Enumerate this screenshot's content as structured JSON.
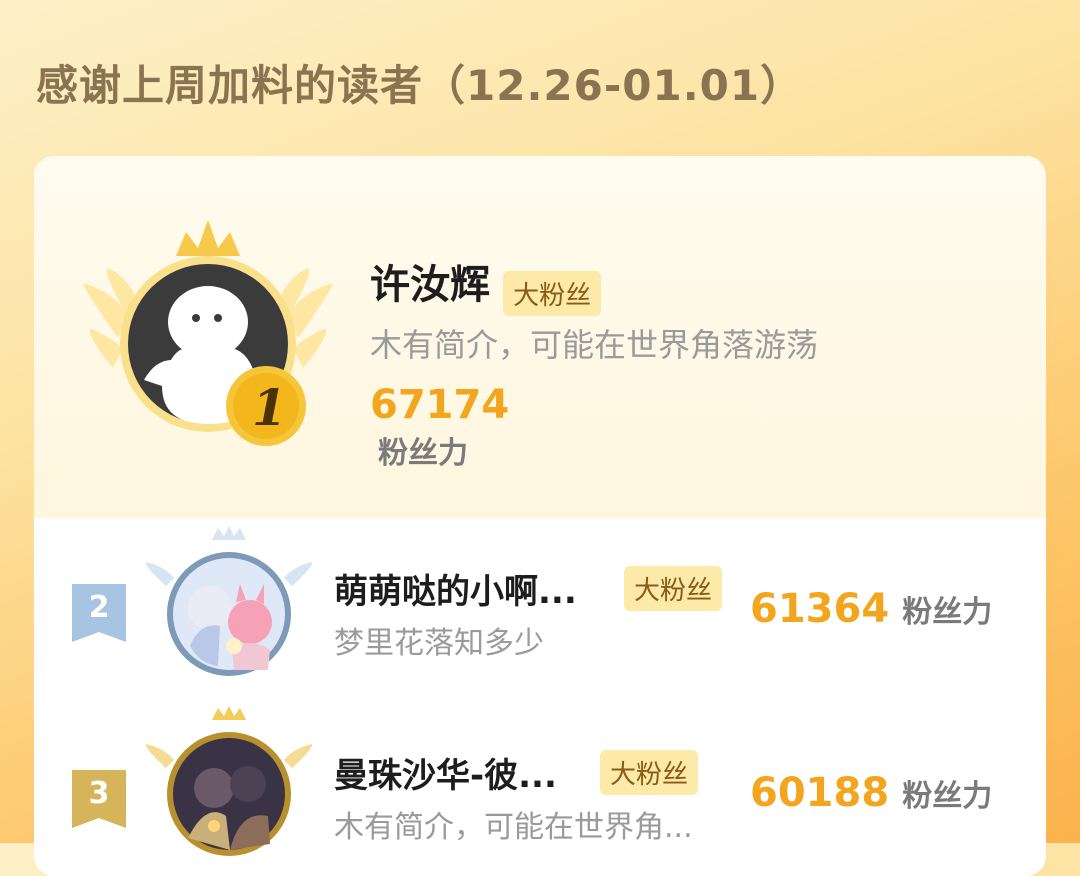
{
  "heading": "感谢上周加料的读者（12.26-01.01）",
  "top_fan": {
    "rank": "1",
    "name": "许汝辉",
    "badge": "大粉丝",
    "bio": "木有简介，可能在世界角落游荡",
    "score": "67174",
    "score_unit": "粉丝力"
  },
  "fans": [
    {
      "rank": "2",
      "name": "萌萌哒的小啊...",
      "badge": "大粉丝",
      "bio": "梦里花落知多少",
      "score": "61364",
      "score_unit": "粉丝力"
    },
    {
      "rank": "3",
      "name": "曼珠沙华-彼...",
      "badge": "大粉丝",
      "bio": "木有简介，可能在世界角...",
      "score": "60188",
      "score_unit": "粉丝力"
    }
  ],
  "colors": {
    "accent": "#f2a51d",
    "badge_bg": "#fde9a8",
    "rank2": "#9cc0e0",
    "rank3": "#d9b65a"
  },
  "icons": {
    "crown": "crown-icon",
    "wings": "wings-icon",
    "default_avatar": "default-avatar-icon",
    "rank_medal": "rank-medal-icon",
    "rank_ribbon": "rank-ribbon-icon"
  }
}
